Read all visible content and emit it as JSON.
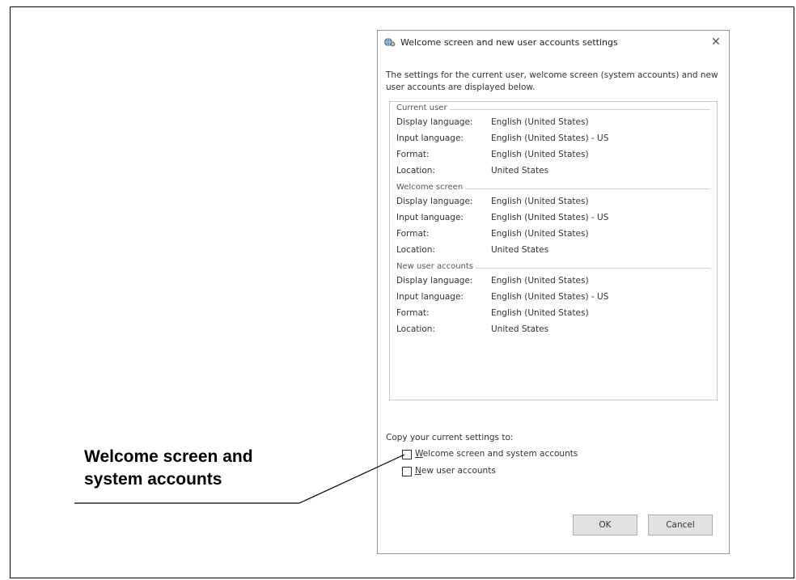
{
  "dialog": {
    "title": "Welcome screen and new user accounts settings",
    "close_glyph": "✕",
    "intro_text": "The settings for the current user, welcome screen (system accounts) and new user accounts are displayed below.",
    "groups": [
      {
        "header": "Current user",
        "rows": [
          {
            "label": "Display language:",
            "value": "English (United States)"
          },
          {
            "label": "Input language:",
            "value": "English (United States) - US"
          },
          {
            "label": "Format:",
            "value": "English (United States)"
          },
          {
            "label": "Location:",
            "value": "United States"
          }
        ]
      },
      {
        "header": "Welcome screen",
        "rows": [
          {
            "label": "Display language:",
            "value": "English (United States)"
          },
          {
            "label": "Input language:",
            "value": "English (United States) - US"
          },
          {
            "label": "Format:",
            "value": "English (United States)"
          },
          {
            "label": "Location:",
            "value": "United States"
          }
        ]
      },
      {
        "header": "New user accounts",
        "rows": [
          {
            "label": "Display language:",
            "value": "English (United States)"
          },
          {
            "label": "Input language:",
            "value": "English (United States) - US"
          },
          {
            "label": "Format:",
            "value": "English (United States)"
          },
          {
            "label": "Location:",
            "value": "United States"
          }
        ]
      }
    ],
    "copy_label": "Copy your current settings to:",
    "checkboxes": [
      {
        "accel": "W",
        "rest": "elcome screen and system accounts",
        "checked": false
      },
      {
        "accel": "N",
        "rest": "ew user accounts",
        "checked": false
      }
    ],
    "ok_label": "OK",
    "cancel_label": "Cancel"
  },
  "callout": {
    "line1": "Welcome screen and",
    "line2": "system accounts"
  },
  "icons": {
    "app_icon": "globe-gear-icon",
    "close_icon": "close-icon"
  },
  "colors": {
    "button_bg": "#e1e1e1",
    "border": "#c4c4c4"
  }
}
